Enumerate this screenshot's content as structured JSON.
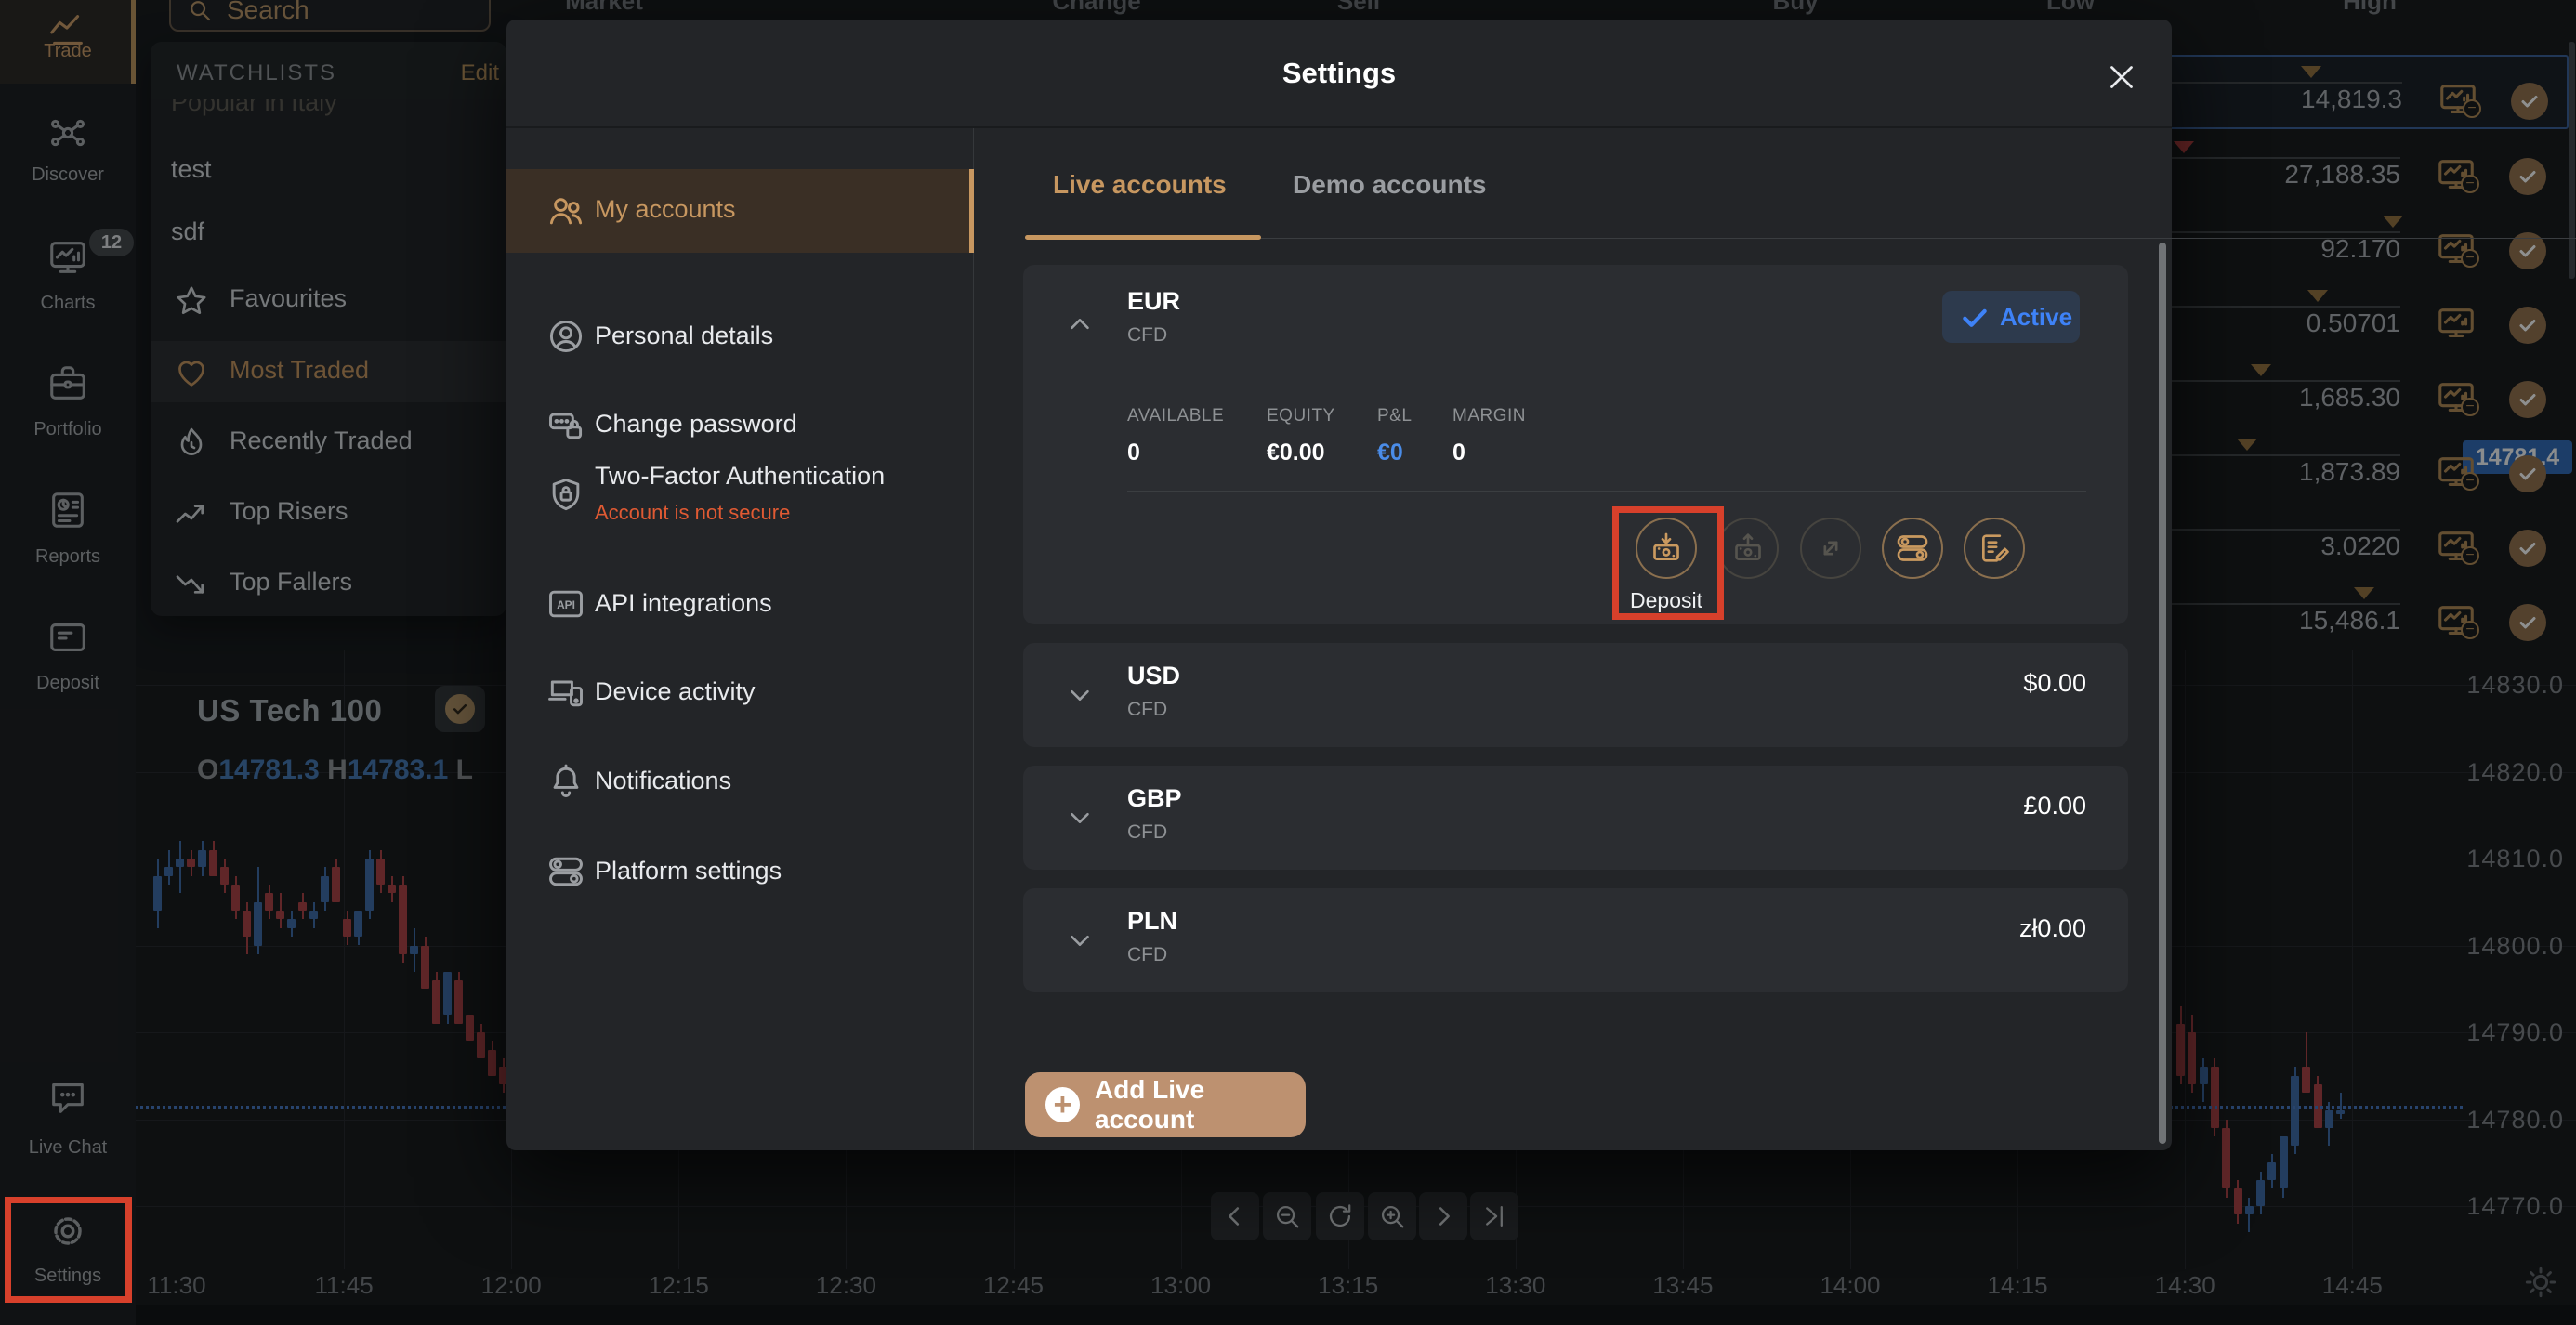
{
  "top_header": {
    "columns": [
      "Market",
      "Change",
      "Sell",
      "Buy",
      "Low",
      "High"
    ]
  },
  "sidebar": {
    "items": [
      {
        "label": "Trade",
        "icon": "trade-icon",
        "active": true
      },
      {
        "label": "Discover",
        "icon": "discover-icon"
      },
      {
        "label": "Charts",
        "icon": "charts-icon",
        "badge": "12"
      },
      {
        "label": "Portfolio",
        "icon": "portfolio-icon"
      },
      {
        "label": "Reports",
        "icon": "reports-icon"
      },
      {
        "label": "Deposit",
        "icon": "deposit-card-icon"
      },
      {
        "label": "Live Chat",
        "icon": "live-chat-icon"
      },
      {
        "label": "Settings",
        "icon": "settings-gear-icon",
        "annotated": true
      }
    ]
  },
  "search": {
    "placeholder": "Search",
    "icon": "search-icon"
  },
  "watchlist": {
    "title": "WATCHLISTS",
    "edit_label": "Edit",
    "scrolled_partial_item": "Popular in Italy",
    "items": [
      {
        "label": "test"
      },
      {
        "label": "sdf"
      },
      {
        "label": "Favourites",
        "icon": "star-icon"
      },
      {
        "label": "Most Traded",
        "icon": "heart-icon",
        "active": true
      },
      {
        "label": "Recently Traded",
        "icon": "recently-traded-icon"
      },
      {
        "label": "Top Risers",
        "icon": "trend-up-icon"
      },
      {
        "label": "Top Fallers",
        "icon": "trend-down-icon"
      }
    ]
  },
  "modal": {
    "title": "Settings",
    "nav": [
      {
        "label": "My accounts",
        "icon": "people-icon",
        "active": true
      },
      {
        "label": "Personal details",
        "icon": "person-icon"
      },
      {
        "label": "Change password",
        "icon": "password-icon"
      },
      {
        "label": "Two-Factor Authentication",
        "icon": "shield-lock-icon",
        "sublabel": "Account is not secure"
      },
      {
        "label": "API integrations",
        "icon": "api-icon"
      },
      {
        "label": "Device activity",
        "icon": "devices-icon"
      },
      {
        "label": "Notifications",
        "icon": "bell-icon"
      },
      {
        "label": "Platform settings",
        "icon": "toggles-icon"
      }
    ],
    "tabs": [
      {
        "label": "Live accounts",
        "active": true
      },
      {
        "label": "Demo accounts",
        "active": false
      }
    ],
    "eur_account": {
      "currency": "EUR",
      "type": "CFD",
      "status": "Active",
      "stats": [
        {
          "label": "AVAILABLE",
          "value": "0"
        },
        {
          "label": "EQUITY",
          "value": "€0.00"
        },
        {
          "label": "P&L",
          "value": "€0",
          "highlight": true
        },
        {
          "label": "MARGIN",
          "value": "0"
        }
      ],
      "actions": [
        {
          "name": "deposit",
          "icon": "deposit-in-icon",
          "label": "Deposit",
          "enabled": true,
          "annotated": true
        },
        {
          "name": "withdraw",
          "icon": "withdraw-out-icon",
          "enabled": false
        },
        {
          "name": "transfer",
          "icon": "transfer-icon",
          "enabled": false
        },
        {
          "name": "manage",
          "icon": "toggles-icon",
          "enabled": true
        },
        {
          "name": "statement",
          "icon": "edit-note-icon",
          "enabled": true
        }
      ]
    },
    "accounts": [
      {
        "currency": "USD",
        "type": "CFD",
        "value": "$0.00"
      },
      {
        "currency": "GBP",
        "type": "CFD",
        "value": "£0.00"
      },
      {
        "currency": "PLN",
        "type": "CFD",
        "value": "zł0.00"
      }
    ],
    "add_account_label": "Add Live account"
  },
  "market_table": {
    "rows": [
      {
        "high": "14,819.3",
        "selected": true,
        "marker_pos": 0.59,
        "marker_color": "gold",
        "minus_badge": true
      },
      {
        "high": "27,188.35",
        "marker_pos": 0.02,
        "marker_color": "red",
        "minus_badge": true
      },
      {
        "high": "92.170",
        "marker_pos": 0.97,
        "marker_color": "gold",
        "minus_badge": true
      },
      {
        "high": "0.50701",
        "marker_pos": 0.63,
        "marker_color": "gold",
        "minus_badge": false
      },
      {
        "high": "1,685.30",
        "marker_pos": 0.37,
        "marker_color": "gold",
        "minus_badge": true
      },
      {
        "high": "1,873.89",
        "marker_pos": 0.31,
        "marker_color": "gold",
        "minus_badge": true
      },
      {
        "high": "3.0220",
        "marker_pos": null,
        "marker_color": "gold",
        "minus_badge": true
      },
      {
        "high": "15,486.1",
        "marker_pos": 0.84,
        "marker_color": "gold",
        "minus_badge": true
      }
    ]
  },
  "chart_data": {
    "type": "candlestick",
    "symbol": "US Tech 100",
    "ohlc_display": {
      "o_label": "O",
      "o": "14781.3",
      "h_label": "H",
      "h": "14783.1",
      "l_label": "L"
    },
    "current_price": "14781.4",
    "y_ticks": [
      "14830.0",
      "14820.0",
      "14810.0",
      "14800.0",
      "14790.0",
      "14780.0",
      "14770.0"
    ],
    "x_ticks": [
      "11:30",
      "11:45",
      "12:00",
      "12:15",
      "12:30",
      "12:45",
      "13:00",
      "13:15",
      "13:30",
      "13:45",
      "14:00",
      "14:15",
      "14:30",
      "14:45"
    ],
    "candles_left": [
      [
        14804,
        14810,
        14802,
        14808
      ],
      [
        14808,
        14811,
        14807,
        14809
      ],
      [
        14809,
        14812,
        14806,
        14810
      ],
      [
        14810,
        14811,
        14808,
        14809
      ],
      [
        14809,
        14812,
        14808,
        14811
      ],
      [
        14811,
        14812,
        14808,
        14808
      ],
      [
        14809,
        14810,
        14806,
        14807
      ],
      [
        14807,
        14808,
        14803,
        14804
      ],
      [
        14804,
        14805,
        14799,
        14801
      ],
      [
        14800,
        14809,
        14799,
        14805
      ],
      [
        14806,
        14807,
        14803,
        14804
      ],
      [
        14804,
        14806,
        14802,
        14803
      ],
      [
        14802,
        14804,
        14801,
        14803
      ],
      [
        14805,
        14806,
        14803,
        14804
      ],
      [
        14803,
        14805,
        14802,
        14804
      ],
      [
        14805,
        14809,
        14804,
        14808
      ],
      [
        14809,
        14810,
        14805,
        14805
      ],
      [
        14803,
        14804,
        14800,
        14801
      ],
      [
        14801,
        14804,
        14800,
        14804
      ],
      [
        14804,
        14811,
        14803,
        14810
      ],
      [
        14810,
        14811,
        14806,
        14807
      ],
      [
        14807,
        14808,
        14805,
        14806
      ],
      [
        14807,
        14808,
        14798,
        14799
      ],
      [
        14799,
        14802,
        14797,
        14800
      ],
      [
        14800,
        14801,
        14795,
        14795
      ],
      [
        14796,
        14797,
        14791,
        14791
      ],
      [
        14792,
        14797,
        14791,
        14797
      ],
      [
        14796,
        14797,
        14791,
        14791
      ],
      [
        14792,
        14792,
        14789,
        14789
      ],
      [
        14790,
        14791,
        14787,
        14787
      ],
      [
        14788,
        14789,
        14785,
        14785
      ],
      [
        14786,
        14787,
        14783,
        14784
      ]
    ],
    "candles_right": [
      [
        14791,
        14793,
        14784,
        14785
      ],
      [
        14790,
        14792,
        14783,
        14784
      ],
      [
        14784,
        14787,
        14782,
        14786
      ],
      [
        14786,
        14787,
        14778,
        14779
      ],
      [
        14779,
        14780,
        14771,
        14772
      ],
      [
        14772,
        14773,
        14768,
        14769
      ],
      [
        14769,
        14771,
        14767,
        14770
      ],
      [
        14770,
        14774,
        14769,
        14773
      ],
      [
        14773,
        14776,
        14772,
        14775
      ],
      [
        14772,
        14778,
        14771,
        14778
      ],
      [
        14777,
        14786,
        14776,
        14785
      ],
      [
        14786,
        14790,
        14783,
        14783
      ],
      [
        14784,
        14785,
        14779,
        14779
      ],
      [
        14779,
        14782,
        14777,
        14781
      ],
      [
        14781,
        14783,
        14780,
        14781
      ]
    ]
  },
  "chart_controls": [
    {
      "name": "pan-left",
      "icon": "chevron-left-icon"
    },
    {
      "name": "zoom-out",
      "icon": "zoom-out-icon"
    },
    {
      "name": "reset-view",
      "icon": "refresh-icon"
    },
    {
      "name": "zoom-in",
      "icon": "zoom-in-icon"
    },
    {
      "name": "pan-right",
      "icon": "chevron-right-icon"
    },
    {
      "name": "go-to-latest",
      "icon": "skip-end-icon"
    }
  ],
  "colors": {
    "accent_gold": "#c2945e",
    "active_blue": "#3e82f7",
    "candle_up": "#38639e",
    "candle_down": "#a03b3e",
    "annotation_red": "#d7402b",
    "price_badge_blue": "#2c62ad",
    "alert_orange": "#e05a33"
  }
}
